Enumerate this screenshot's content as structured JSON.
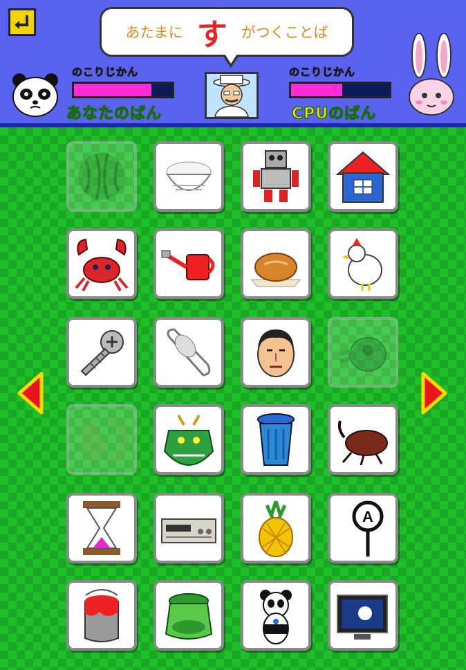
{
  "header": {
    "back_icon": "return-arrow-icon",
    "prompt": {
      "prefix": "あたまに",
      "kana": "す",
      "suffix": "がつくことば"
    },
    "player": {
      "time_label": "のこりじかん",
      "board_label": "あなたのばん",
      "time_fraction": 0.79,
      "avatar": "panda-icon"
    },
    "cpu": {
      "time_label": "のこりじかん",
      "board_label": "CPUのばん",
      "time_fraction": 0.52,
      "avatar": "rabbit-icon"
    },
    "host": "host-man-icon"
  },
  "colors": {
    "header_bg": "#5a63f0",
    "board_green": "#1fbf2a",
    "timer_fill": "#ff2bd9",
    "prompt_kana": "#e5232a",
    "prompt_text": "#e08a1e"
  },
  "cards": [
    {
      "icon": "watermelon-icon",
      "taken": true
    },
    {
      "icon": "rice-bowl-icon",
      "taken": false
    },
    {
      "icon": "robot-icon",
      "taken": false
    },
    {
      "icon": "house-icon",
      "taken": false
    },
    {
      "icon": "crab-icon",
      "taken": false
    },
    {
      "icon": "watering-can-icon",
      "taken": false
    },
    {
      "icon": "bread-icon",
      "taken": false
    },
    {
      "icon": "rooster-icon",
      "taken": false
    },
    {
      "icon": "screw-icon",
      "taken": false
    },
    {
      "icon": "toilet-icon",
      "taken": false
    },
    {
      "icon": "man-face-icon",
      "taken": false
    },
    {
      "icon": "frog-icon",
      "taken": true
    },
    {
      "icon": "squirrel-icon",
      "taken": true
    },
    {
      "icon": "dragon-icon",
      "taken": false
    },
    {
      "icon": "trash-can-icon",
      "taken": false
    },
    {
      "icon": "beetle-icon",
      "taken": false
    },
    {
      "icon": "hourglass-icon",
      "taken": false
    },
    {
      "icon": "video-deck-icon",
      "taken": false
    },
    {
      "icon": "pineapple-icon",
      "taken": false
    },
    {
      "icon": "magnifier-sign-icon",
      "taken": false
    },
    {
      "icon": "paint-can-icon",
      "taken": false
    },
    {
      "icon": "kappa-icon",
      "taken": false
    },
    {
      "icon": "panda-icon",
      "taken": false
    },
    {
      "icon": "television-icon",
      "taken": false
    }
  ],
  "nav": {
    "prev_icon": "left-arrow-icon",
    "next_icon": "right-arrow-icon"
  }
}
